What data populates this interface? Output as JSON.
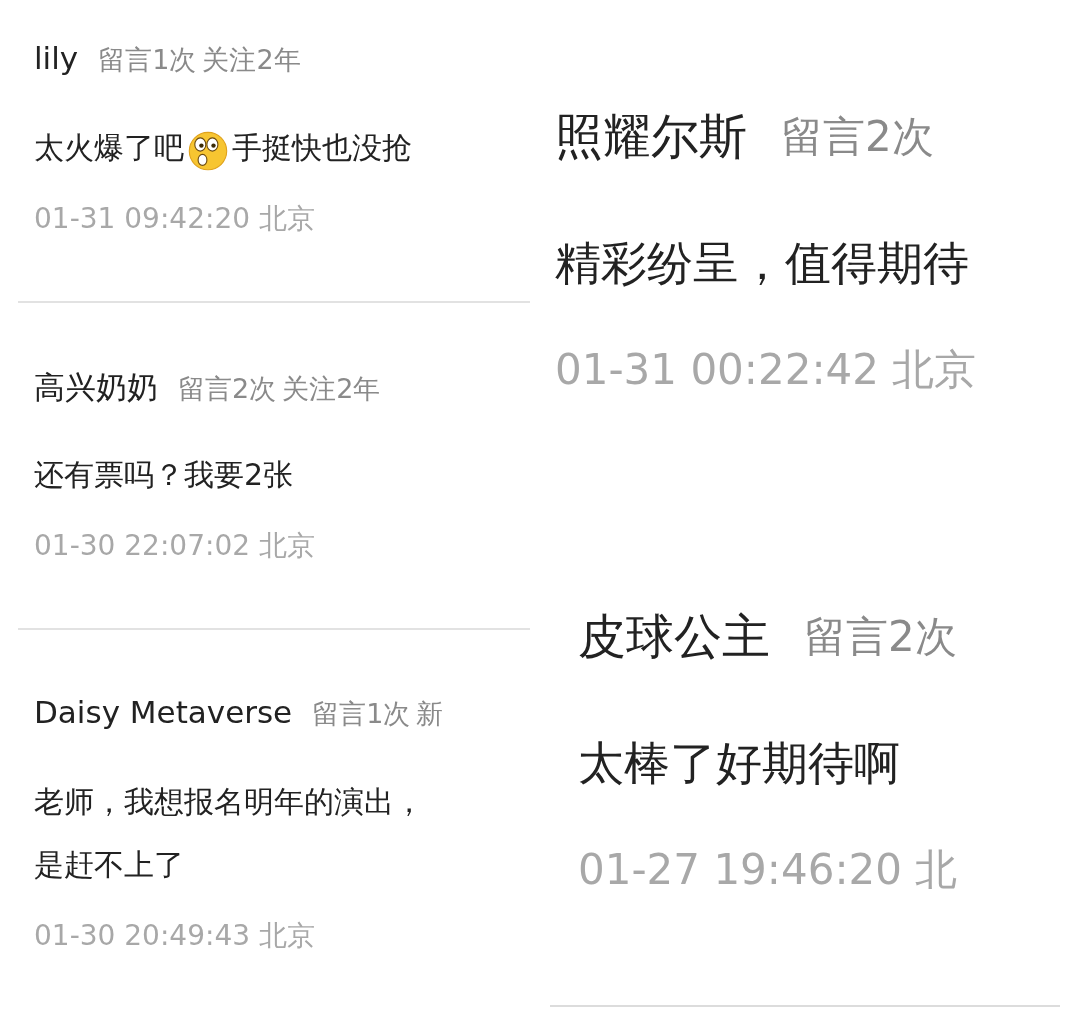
{
  "panels": [
    {
      "comments": [
        {
          "name": "lily",
          "meta": [
            "留言1次",
            "关注2年"
          ],
          "body": [
            {
              "kind": "text",
              "text": "太火爆了吧"
            },
            {
              "kind": "emoji"
            },
            {
              "kind": "text",
              "text": "手挺快也没抢"
            }
          ],
          "time": "01-31 09:42:20 北京",
          "divider": true
        },
        {
          "name": "高兴奶奶",
          "meta": [
            "留言2次",
            "关注2年"
          ],
          "body": [
            {
              "kind": "text",
              "text": "还有票吗？我要2张"
            }
          ],
          "time": "01-30 22:07:02 北京",
          "divider": true
        },
        {
          "name": "Daisy Metaverse",
          "meta": [
            "留言1次",
            "新"
          ],
          "body": [
            {
              "kind": "text",
              "text": "老师，我想报名明年的演出，"
            },
            {
              "kind": "break"
            },
            {
              "kind": "text",
              "text": "是赶不上了"
            }
          ],
          "time": "01-30 20:49:43 北京",
          "divider": false
        }
      ]
    },
    {
      "comments": [
        {
          "name": "照耀尔斯",
          "meta": [
            "留言2次"
          ],
          "body": [
            {
              "kind": "text",
              "text": "精彩纷呈，值得期待"
            }
          ],
          "time": "01-31 00:22:42 北京",
          "divider": false
        },
        {
          "name": "皮球公主",
          "meta": [
            "留言2次"
          ],
          "body": [
            {
              "kind": "text",
              "text": "太棒了好期待啊"
            }
          ],
          "time": "01-27 19:46:20 北",
          "divider": true
        }
      ]
    }
  ]
}
